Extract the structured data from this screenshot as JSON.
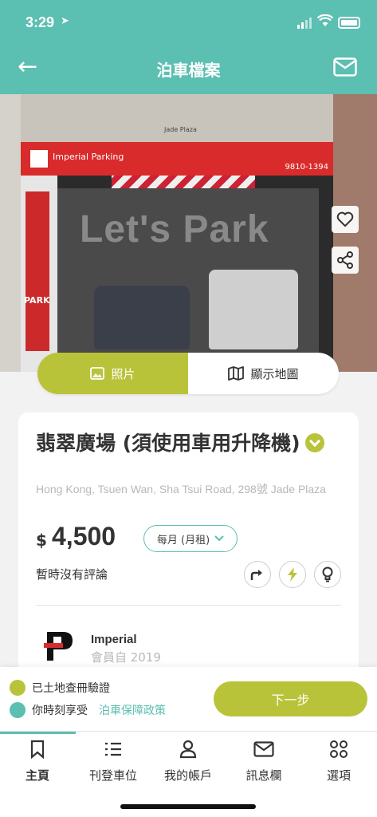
{
  "status_bar": {
    "time": "3:29"
  },
  "nav": {
    "title": "泊車檔案"
  },
  "photo": {
    "sign_name": "Imperial Parking",
    "sign_phone": "9810-1394",
    "building_sign": "Jade Plaza",
    "watermark": "Let's Park",
    "pillar_text": "PARK"
  },
  "view_toggle": {
    "photos": "照片",
    "map": "顯示地圖"
  },
  "listing": {
    "title": "翡翠廣場 (須使用車用升降機)",
    "address": "Hong Kong, Tsuen Wan, Sha Tsui Road, 298號 Jade Plaza",
    "currency": "$",
    "price": "4,500",
    "period": "每月 (月租)",
    "reviews": "暫時沒有評論",
    "owner": "Imperial",
    "member_since": "會員自 2019"
  },
  "action": {
    "verified_text": "已土地查冊驗證",
    "guarantee_text": "你時刻享受",
    "policy_link": "泊車保障政策",
    "next_button": "下一步"
  },
  "tabs": [
    {
      "label": "主頁",
      "icon": "bookmark-icon"
    },
    {
      "label": "刊登車位",
      "icon": "list-icon"
    },
    {
      "label": "我的帳戶",
      "icon": "person-icon"
    },
    {
      "label": "訊息欄",
      "icon": "mail-icon"
    },
    {
      "label": "選項",
      "icon": "grid-icon"
    }
  ],
  "colors": {
    "primary": "#5bbfb1",
    "accent": "#b9c33a"
  }
}
